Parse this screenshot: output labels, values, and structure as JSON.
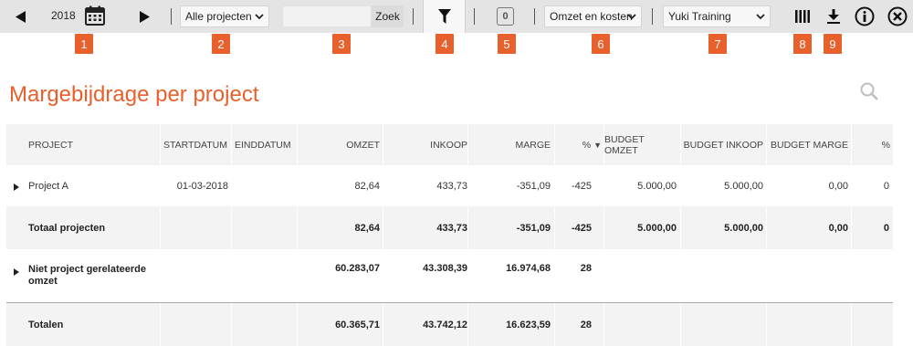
{
  "toolbar": {
    "year": "2018",
    "project_filter": "Alle projecten",
    "search_value": "",
    "search_button": "Zoek",
    "filter_count": "0",
    "view_select": "Omzet en kosten",
    "administration_select": "Yuki Training"
  },
  "markers": [
    "1",
    "2",
    "3",
    "4",
    "5",
    "6",
    "7",
    "8",
    "9"
  ],
  "page": {
    "title": "Margebijdrage per project"
  },
  "table": {
    "headers": {
      "project": "PROJECT",
      "startdatum": "STARTDATUM",
      "einddatum": "EINDDATUM",
      "omzet": "OMZET",
      "inkoop": "INKOOP",
      "marge": "MARGE",
      "pct": "%",
      "budget_omzet": "BUDGET OMZET",
      "budget_inkoop": "BUDGET INKOOP",
      "budget_marge": "BUDGET MARGE",
      "budget_pct": "%"
    },
    "sort_indicator": "▼",
    "project_row": {
      "project": "Project A",
      "startdatum": "01-03-2018",
      "einddatum": "",
      "omzet": "82,64",
      "inkoop": "433,73",
      "marge": "-351,09",
      "pct": "-425",
      "budget_omzet": "5.000,00",
      "budget_inkoop": "5.000,00",
      "budget_marge": "0,00",
      "budget_pct": "0"
    },
    "total_projects_row": {
      "project": "Totaal projecten",
      "omzet": "82,64",
      "inkoop": "433,73",
      "marge": "-351,09",
      "pct": "-425",
      "budget_omzet": "5.000,00",
      "budget_inkoop": "5.000,00",
      "budget_marge": "0,00",
      "budget_pct": "0"
    },
    "non_project_row": {
      "project_line1": "Niet project gerelateerde",
      "project_line2": "omzet",
      "omzet": "60.283,07",
      "inkoop": "43.308,39",
      "marge": "16.974,68",
      "pct": "28"
    },
    "totals_row": {
      "project": "Totalen",
      "omzet": "60.365,71",
      "inkoop": "43.742,12",
      "marge": "16.623,59",
      "pct": "28"
    }
  },
  "colors": {
    "accent": "#e8602c",
    "toolbar_bg": "#e4e4e4",
    "row_alt_bg": "#f3f3f3"
  }
}
